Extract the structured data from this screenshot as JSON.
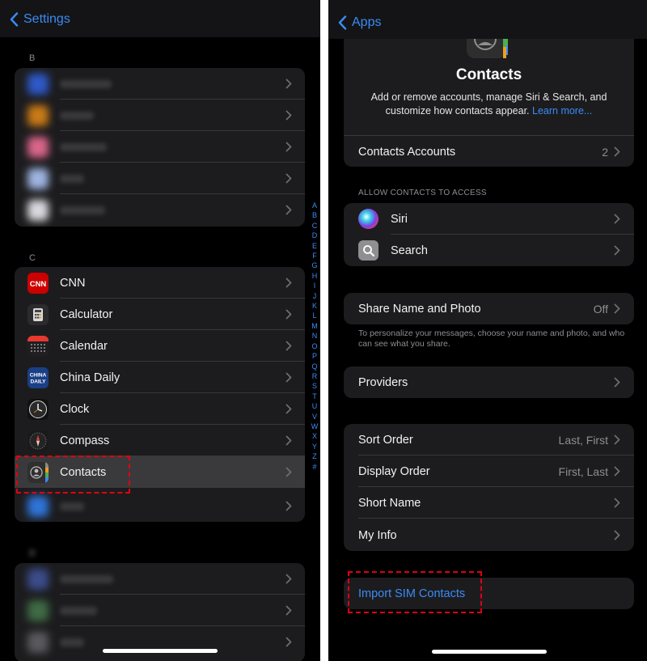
{
  "left": {
    "nav_back_label": "Settings",
    "index_letters": [
      "A",
      "B",
      "C",
      "D",
      "E",
      "F",
      "G",
      "H",
      "I",
      "J",
      "K",
      "L",
      "M",
      "N",
      "O",
      "P",
      "Q",
      "R",
      "S",
      "T",
      "U",
      "V",
      "W",
      "X",
      "Y",
      "Z",
      "#"
    ],
    "section_b": {
      "letter": "B"
    },
    "section_c": {
      "letter": "C",
      "items": [
        {
          "label": "CNN",
          "icon": "cnn-icon"
        },
        {
          "label": "Calculator",
          "icon": "calculator-icon"
        },
        {
          "label": "Calendar",
          "icon": "calendar-icon"
        },
        {
          "label": "China Daily",
          "icon": "china-daily-icon"
        },
        {
          "label": "Clock",
          "icon": "clock-icon"
        },
        {
          "label": "Compass",
          "icon": "compass-icon"
        },
        {
          "label": "Contacts",
          "icon": "contacts-icon",
          "selected": true
        }
      ]
    }
  },
  "right": {
    "nav_back_label": "Apps",
    "hero": {
      "title": "Contacts",
      "description": "Add or remove accounts, manage Siri & Search, and customize how contacts appear.",
      "learn_more": "Learn more..."
    },
    "contacts_accounts": {
      "label": "Contacts Accounts",
      "value": "2"
    },
    "access_section": {
      "header": "ALLOW CONTACTS TO ACCESS",
      "items": [
        {
          "label": "Siri",
          "icon": "siri-icon"
        },
        {
          "label": "Search",
          "icon": "search-icon"
        }
      ]
    },
    "share": {
      "label": "Share Name and Photo",
      "value": "Off",
      "footnote": "To personalize your messages, choose your name and photo, and who can see what you share."
    },
    "providers": {
      "label": "Providers"
    },
    "display_settings": [
      {
        "label": "Sort Order",
        "value": "Last, First"
      },
      {
        "label": "Display Order",
        "value": "First, Last"
      },
      {
        "label": "Short Name",
        "value": ""
      },
      {
        "label": "My Info",
        "value": ""
      }
    ],
    "import_sim": {
      "label": "Import SIM Contacts"
    }
  },
  "colors": {
    "accent": "#3a8cf5",
    "highlight": "#e00012",
    "cell_bg": "#1c1c1e",
    "selected_bg": "#3a3a3c"
  }
}
